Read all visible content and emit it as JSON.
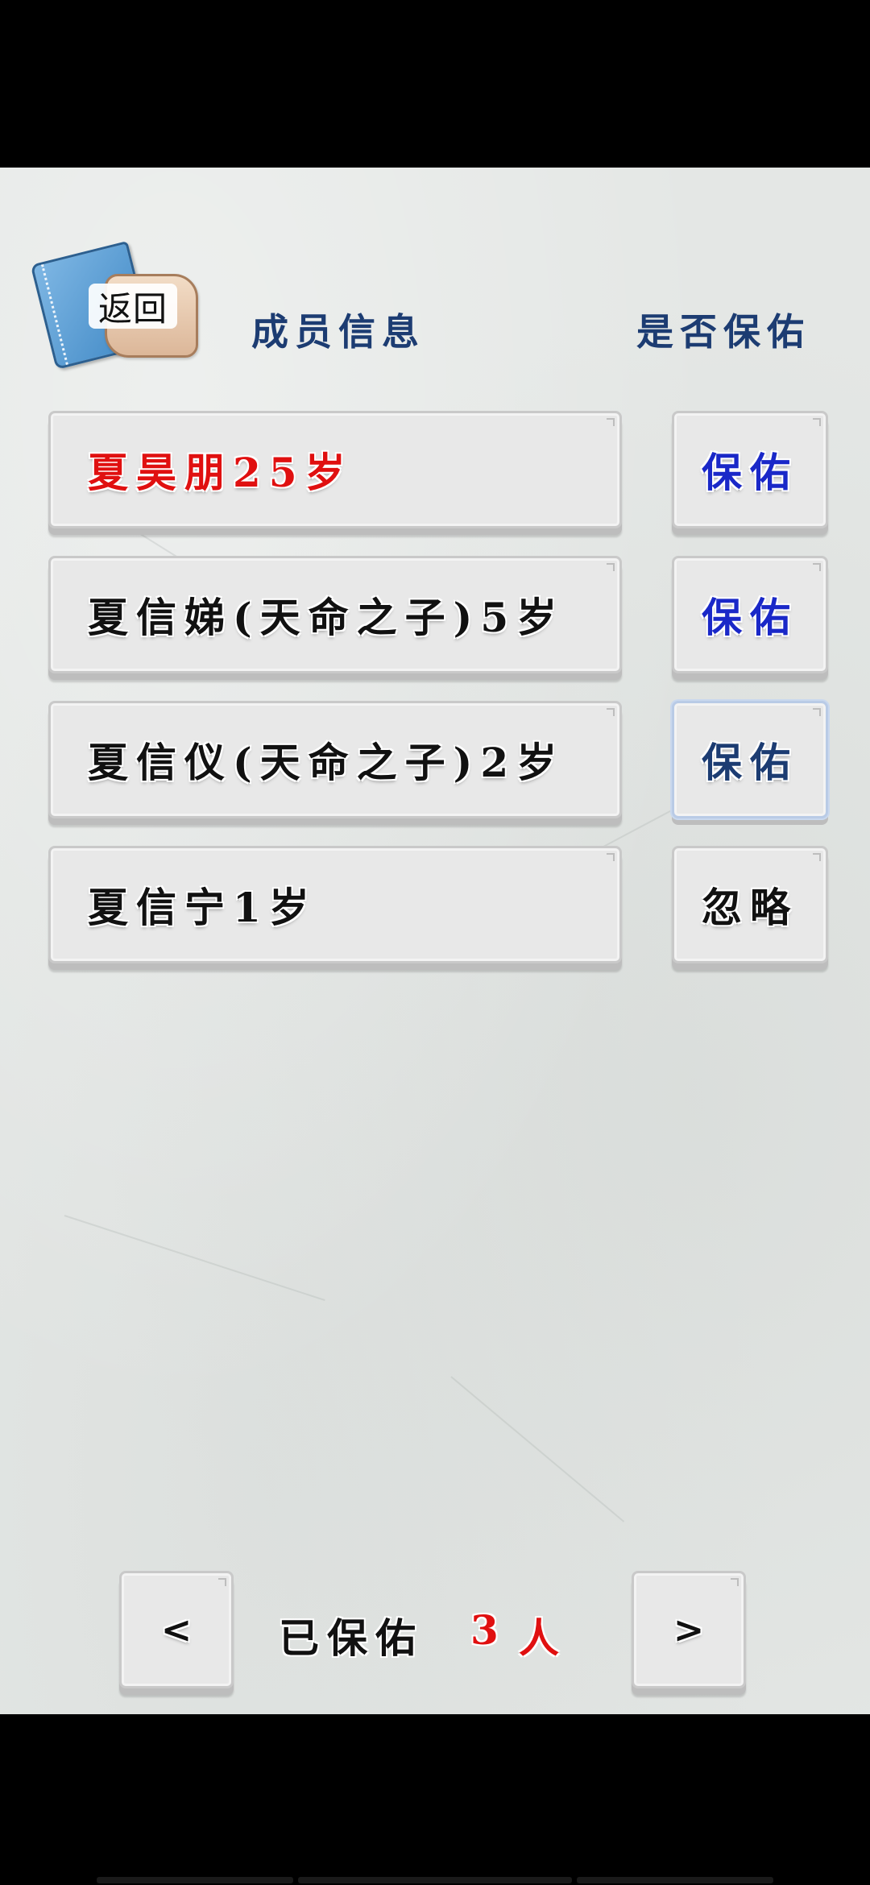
{
  "header": {
    "back_label": "返回",
    "member_col": "成员信息",
    "protect_col": "是否保佑"
  },
  "colors": {
    "header_text": "#1c3c72",
    "highlight_red": "#e01010",
    "protect_blue": "#1a28c8",
    "dark_text": "#111111"
  },
  "members": [
    {
      "name": "夏昊朋25岁",
      "name_color": "#e01010",
      "action": "保佑",
      "action_color": "#1a28c8",
      "selected": false
    },
    {
      "name": "夏信娣(天命之子)5岁",
      "name_color": "#111111",
      "action": "保佑",
      "action_color": "#1a28c8",
      "selected": false
    },
    {
      "name": "夏信仪(天命之子)2岁",
      "name_color": "#111111",
      "action": "保佑",
      "action_color": "#1c3c72",
      "selected": true
    },
    {
      "name": "夏信宁1岁",
      "name_color": "#111111",
      "action": "忽略",
      "action_color": "#111111",
      "selected": false
    }
  ],
  "footer": {
    "prev_label": "<",
    "next_label": ">",
    "blessed_label": "已保佑",
    "count": "3",
    "unit": "人"
  }
}
